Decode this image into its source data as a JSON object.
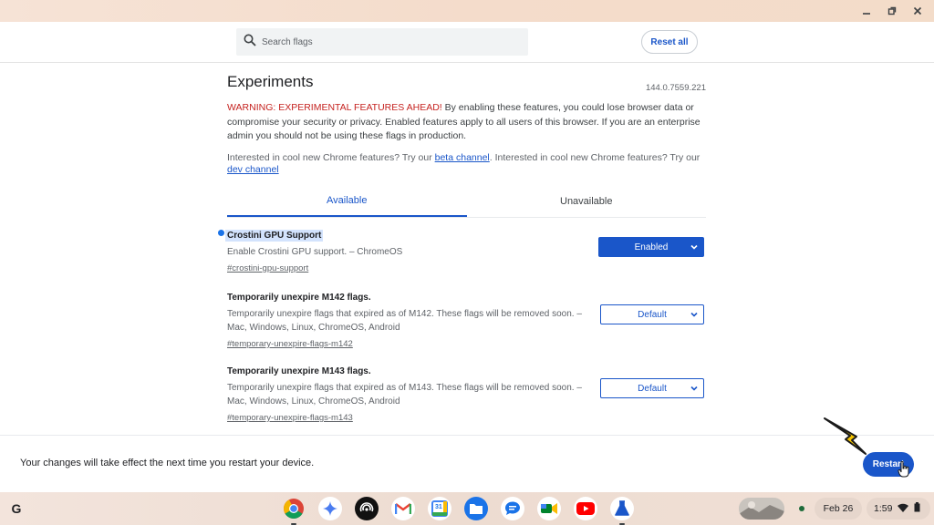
{
  "window": {
    "controls": [
      "minimize-icon",
      "restore-icon",
      "close-icon"
    ]
  },
  "header": {
    "search_placeholder": "Search flags",
    "reset_label": "Reset all"
  },
  "main": {
    "title": "Experiments",
    "version": "144.0.7559.221",
    "warning_prefix": "WARNING: EXPERIMENTAL FEATURES AHEAD!",
    "warning_body": " By enabling these features, you could lose browser data or compromise your security or privacy. Enabled features apply to all users of this browser. If you are an enterprise admin you should not be using these flags in production.",
    "interest_text_1": "Interested in cool new Chrome features? Try our ",
    "beta_link": "beta channel",
    "interest_text_2": ". Interested in cool new Chrome features? Try our ",
    "dev_link": "dev channel",
    "tabs": [
      {
        "label": "Available",
        "active": true
      },
      {
        "label": "Unavailable",
        "active": false
      }
    ],
    "flags": [
      {
        "title": "Crostini GPU Support",
        "description": "Enable Crostini GPU support. – ChromeOS",
        "link": "#crostini-gpu-support",
        "value": "Enabled"
      },
      {
        "title": "Temporarily unexpire M142 flags.",
        "description": "Temporarily unexpire flags that expired as of M142. These flags will be removed soon. – Mac, Windows, Linux, ChromeOS, Android",
        "link": "#temporary-unexpire-flags-m142",
        "value": "Default"
      },
      {
        "title": "Temporarily unexpire M143 flags.",
        "description": "Temporarily unexpire flags that expired as of M143. These flags will be removed soon. – Mac, Windows, Linux, ChromeOS, Android",
        "link": "#temporary-unexpire-flags-m143",
        "value": "Default"
      }
    ]
  },
  "restart_bar": {
    "message": "Your changes will take effect the next time you restart your device.",
    "button_label": "Restart"
  },
  "shelf": {
    "launcher_label": "G",
    "apps": [
      "chrome-icon",
      "gemini-icon",
      "podcast-icon",
      "gmail-icon",
      "calendar-icon",
      "files-icon",
      "messages-icon",
      "meet-icon",
      "youtube-icon",
      "chrome-beta-icon"
    ],
    "calendar_day": "31",
    "date": "Feb 26",
    "time": "1:59"
  },
  "colors": {
    "accent": "#1a56c9",
    "warning": "#c5221f"
  }
}
